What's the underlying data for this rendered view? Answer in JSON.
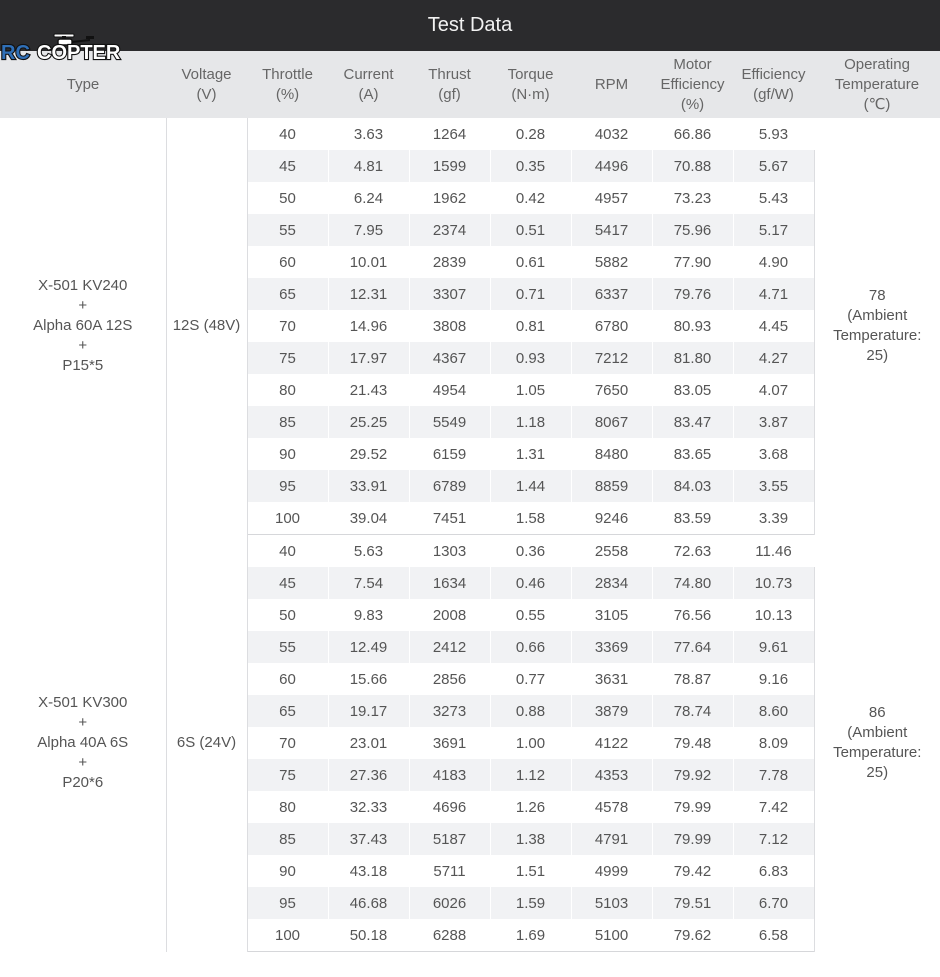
{
  "title": "Test Data",
  "logo": {
    "text_rc": "RC",
    "text_copter": "COPTER",
    "icon": "drone-icon"
  },
  "colors": {
    "title_bg": "#2b2b2d",
    "header_bg": "#e6e7e9",
    "alt_row": "#f1f2f4",
    "logo_blue": "#2f6fb7"
  },
  "headers": [
    {
      "key": "type",
      "lines": [
        "Type"
      ]
    },
    {
      "key": "voltage",
      "lines": [
        "Voltage",
        "(V)"
      ]
    },
    {
      "key": "throttle",
      "lines": [
        "Throttle",
        "(%)"
      ]
    },
    {
      "key": "current",
      "lines": [
        "Current",
        "(A)"
      ]
    },
    {
      "key": "thrust",
      "lines": [
        "Thrust",
        "(gf)"
      ]
    },
    {
      "key": "torque",
      "lines": [
        "Torque",
        "(N·m)"
      ]
    },
    {
      "key": "rpm",
      "lines": [
        "RPM"
      ]
    },
    {
      "key": "motor_eff",
      "lines": [
        "Motor",
        "Efficiency",
        "(%)"
      ]
    },
    {
      "key": "eff",
      "lines": [
        "Efficiency",
        "(gf/W)"
      ]
    },
    {
      "key": "temp",
      "lines": [
        "Operating",
        "Temperature",
        "(℃)"
      ]
    }
  ],
  "groups": [
    {
      "type": [
        "X-501 KV240",
        "+",
        "Alpha 60A 12S",
        "+",
        "P15*5"
      ],
      "voltage": "12S (48V)",
      "temperature": [
        "78",
        "(Ambient",
        "Temperature:",
        "25)"
      ],
      "rows": [
        [
          "40",
          "3.63",
          "1264",
          "0.28",
          "4032",
          "66.86",
          "5.93"
        ],
        [
          "45",
          "4.81",
          "1599",
          "0.35",
          "4496",
          "70.88",
          "5.67"
        ],
        [
          "50",
          "6.24",
          "1962",
          "0.42",
          "4957",
          "73.23",
          "5.43"
        ],
        [
          "55",
          "7.95",
          "2374",
          "0.51",
          "5417",
          "75.96",
          "5.17"
        ],
        [
          "60",
          "10.01",
          "2839",
          "0.61",
          "5882",
          "77.90",
          "4.90"
        ],
        [
          "65",
          "12.31",
          "3307",
          "0.71",
          "6337",
          "79.76",
          "4.71"
        ],
        [
          "70",
          "14.96",
          "3808",
          "0.81",
          "6780",
          "80.93",
          "4.45"
        ],
        [
          "75",
          "17.97",
          "4367",
          "0.93",
          "7212",
          "81.80",
          "4.27"
        ],
        [
          "80",
          "21.43",
          "4954",
          "1.05",
          "7650",
          "83.05",
          "4.07"
        ],
        [
          "85",
          "25.25",
          "5549",
          "1.18",
          "8067",
          "83.47",
          "3.87"
        ],
        [
          "90",
          "29.52",
          "6159",
          "1.31",
          "8480",
          "83.65",
          "3.68"
        ],
        [
          "95",
          "33.91",
          "6789",
          "1.44",
          "8859",
          "84.03",
          "3.55"
        ],
        [
          "100",
          "39.04",
          "7451",
          "1.58",
          "9246",
          "83.59",
          "3.39"
        ]
      ]
    },
    {
      "type": [
        "X-501 KV300",
        "+",
        "Alpha 40A 6S",
        "+",
        "P20*6"
      ],
      "voltage": "6S (24V)",
      "temperature": [
        "86",
        "(Ambient",
        "Temperature:",
        "25)"
      ],
      "rows": [
        [
          "40",
          "5.63",
          "1303",
          "0.36",
          "2558",
          "72.63",
          "11.46"
        ],
        [
          "45",
          "7.54",
          "1634",
          "0.46",
          "2834",
          "74.80",
          "10.73"
        ],
        [
          "50",
          "9.83",
          "2008",
          "0.55",
          "3105",
          "76.56",
          "10.13"
        ],
        [
          "55",
          "12.49",
          "2412",
          "0.66",
          "3369",
          "77.64",
          "9.61"
        ],
        [
          "60",
          "15.66",
          "2856",
          "0.77",
          "3631",
          "78.87",
          "9.16"
        ],
        [
          "65",
          "19.17",
          "3273",
          "0.88",
          "3879",
          "78.74",
          "8.60"
        ],
        [
          "70",
          "23.01",
          "3691",
          "1.00",
          "4122",
          "79.48",
          "8.09"
        ],
        [
          "75",
          "27.36",
          "4183",
          "1.12",
          "4353",
          "79.92",
          "7.78"
        ],
        [
          "80",
          "32.33",
          "4696",
          "1.26",
          "4578",
          "79.99",
          "7.42"
        ],
        [
          "85",
          "37.43",
          "5187",
          "1.38",
          "4791",
          "79.99",
          "7.12"
        ],
        [
          "90",
          "43.18",
          "5711",
          "1.51",
          "4999",
          "79.42",
          "6.83"
        ],
        [
          "95",
          "46.68",
          "6026",
          "1.59",
          "5103",
          "79.51",
          "6.70"
        ],
        [
          "100",
          "50.18",
          "6288",
          "1.69",
          "5100",
          "79.62",
          "6.58"
        ]
      ]
    }
  ]
}
